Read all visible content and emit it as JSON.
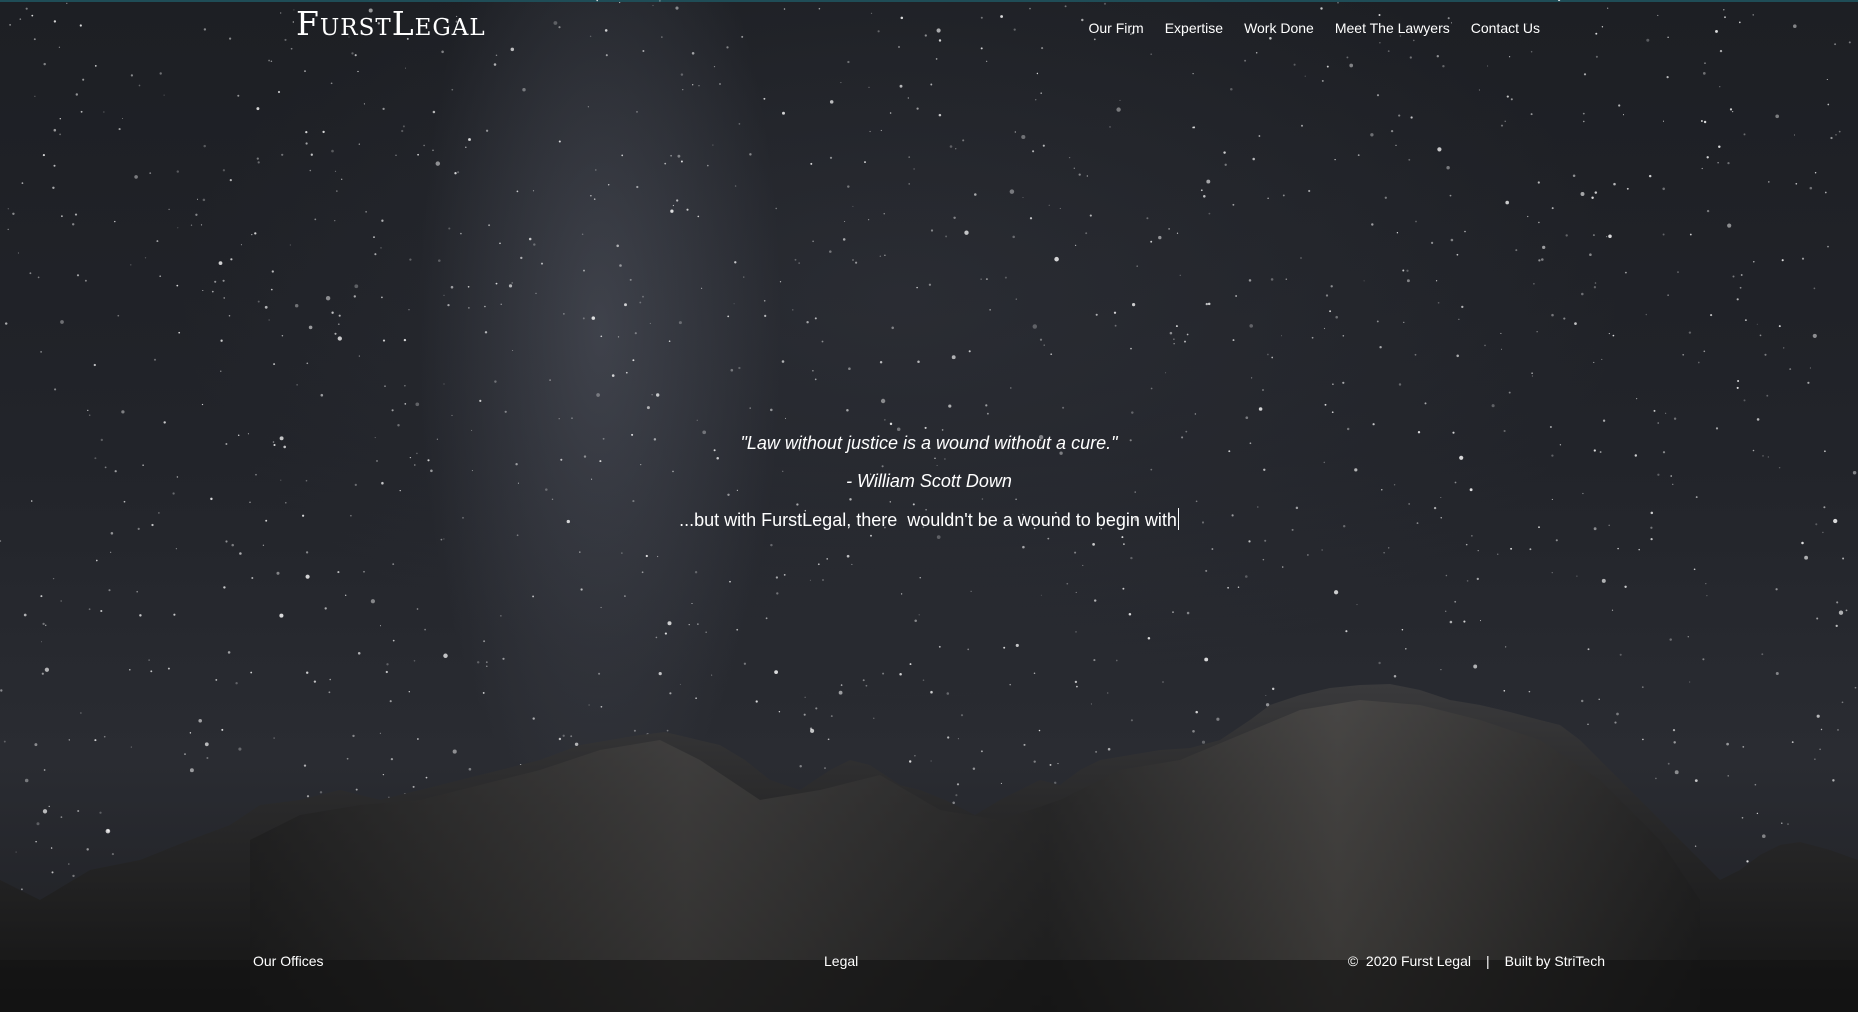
{
  "brand": {
    "logo_text": "FurstLegal"
  },
  "nav": {
    "items": [
      {
        "label": "Our Firm"
      },
      {
        "label": "Expertise"
      },
      {
        "label": "Work Done"
      },
      {
        "label": "Meet The Lawyers"
      },
      {
        "label": "Contact Us"
      }
    ]
  },
  "hero": {
    "quote": "\"Law without justice is a wound without a cure.\"",
    "author": "- William Scott Down",
    "tagline": "...but with FurstLegal, there  wouldn't be a wound to begin with"
  },
  "footer": {
    "offices_label": "Our Offices",
    "legal_label": "Legal",
    "copyright": "©  2020 Furst Legal",
    "separator": "|",
    "credit": "Built by StriTech"
  },
  "colors": {
    "text": "#ffffff",
    "sky": "#22242a",
    "accent_line": "#1f4d57"
  }
}
